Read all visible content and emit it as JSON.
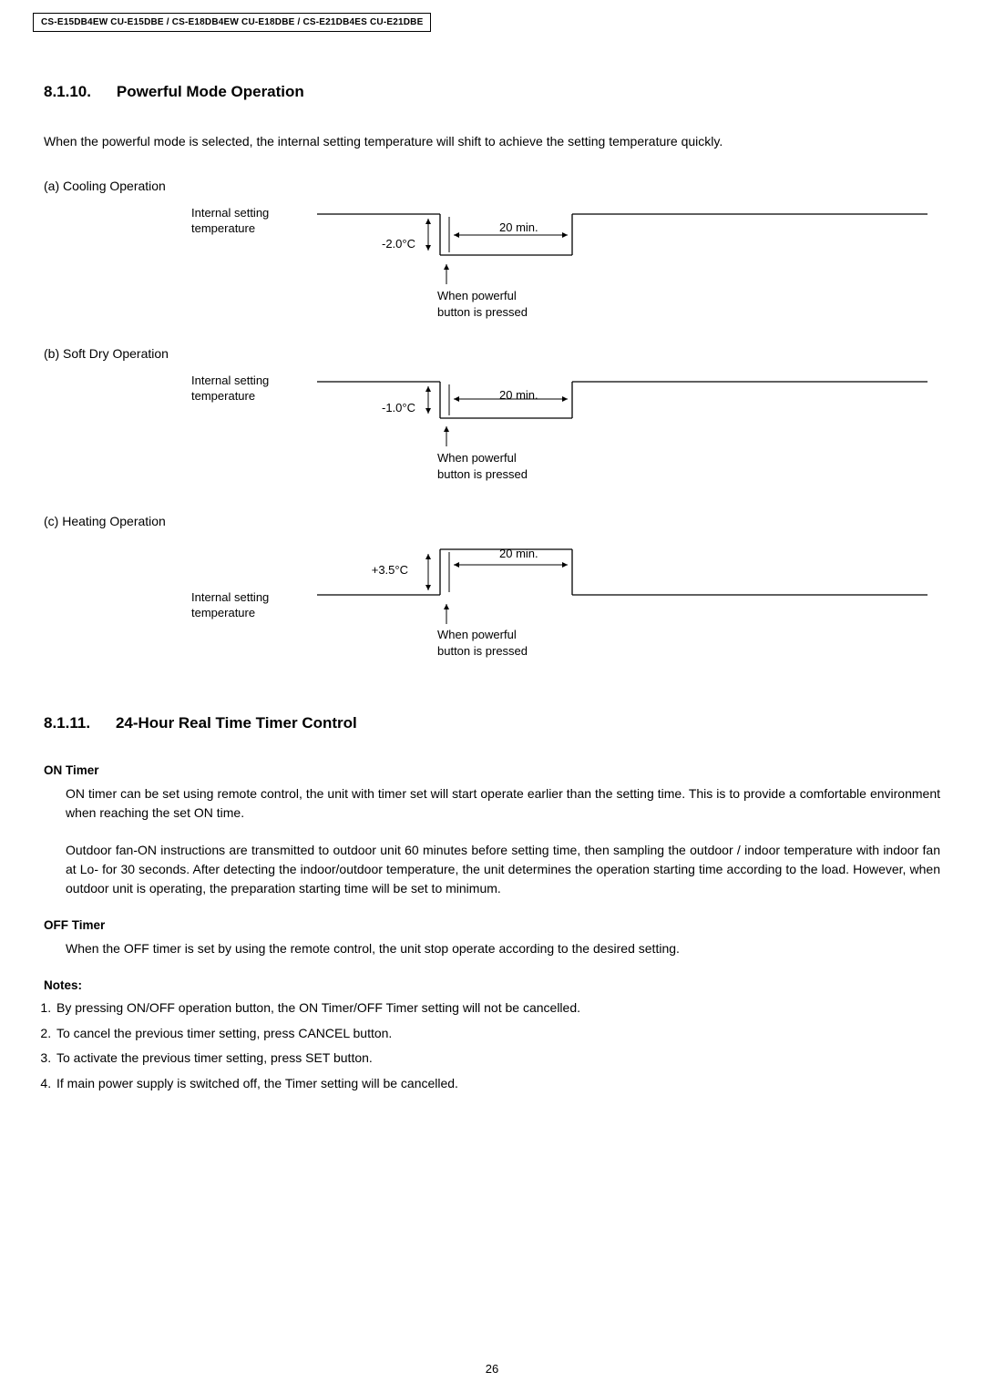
{
  "header": "CS-E15DB4EW CU-E15DBE / CS-E18DB4EW CU-E18DBE / CS-E21DB4ES CU-E21DBE",
  "s1": {
    "num": "8.1.10.",
    "title": "Powerful Mode Operation",
    "intro": "When the powerful mode is selected, the internal setting temperature will shift to achieve the setting temperature quickly.",
    "a": {
      "label": "(a) Cooling Operation",
      "ist": "Internal setting\ntemperature",
      "temp": "-2.0°C",
      "duration": "20 min.",
      "press": "When powerful\nbutton is pressed"
    },
    "b": {
      "label": "(b) Soft Dry Operation",
      "ist": "Internal setting\ntemperature",
      "temp": "-1.0°C",
      "duration": "20 min.",
      "press": "When powerful\nbutton is pressed"
    },
    "c": {
      "label": "(c) Heating Operation",
      "ist": "Internal setting\ntemperature",
      "temp": "+3.5°C",
      "duration": "20 min.",
      "press": "When powerful\nbutton is pressed"
    }
  },
  "s2": {
    "num": "8.1.11.",
    "title": "24-Hour Real Time Timer Control",
    "on_hdr": "ON Timer",
    "on_p1": "ON timer can be set using remote control, the unit with timer set will start operate earlier than the setting time. This is to provide a comfortable environment when reaching the set ON time.",
    "on_p2": "Outdoor fan-ON instructions are transmitted to outdoor unit 60 minutes before setting time, then sampling the outdoor / indoor temperature with indoor fan at Lo- for 30 seconds. After detecting the indoor/outdoor temperature, the unit determines the operation starting time according to the load. However, when outdoor unit is operating, the preparation starting time will be set to minimum.",
    "off_hdr": "OFF Timer",
    "off_p1": "When the OFF timer is set by using the remote control, the unit stop operate according to the desired setting.",
    "notes_hdr": "Notes:",
    "notes": [
      "By pressing ON/OFF operation button, the ON Timer/OFF Timer setting will not be cancelled.",
      "To cancel the previous timer setting, press CANCEL button.",
      "To activate the previous timer setting, press SET button.",
      "If main power supply is switched off, the Timer setting will be cancelled."
    ]
  },
  "page": "26",
  "chart_data": [
    {
      "type": "step",
      "name": "Cooling Operation",
      "baseline_label": "Internal setting temperature",
      "offset_c": -2.0,
      "duration_min": 20,
      "direction": "down",
      "trigger": "When powerful button is pressed"
    },
    {
      "type": "step",
      "name": "Soft Dry Operation",
      "baseline_label": "Internal setting temperature",
      "offset_c": -1.0,
      "duration_min": 20,
      "direction": "down",
      "trigger": "When powerful button is pressed"
    },
    {
      "type": "step",
      "name": "Heating Operation",
      "baseline_label": "Internal setting temperature",
      "offset_c": 3.5,
      "duration_min": 20,
      "direction": "up",
      "trigger": "When powerful button is pressed"
    }
  ]
}
